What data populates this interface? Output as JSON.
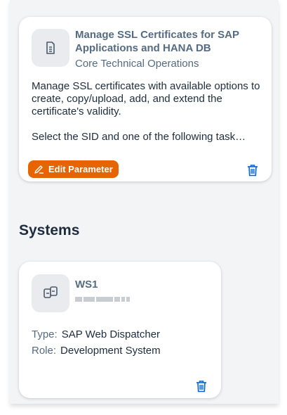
{
  "task_card": {
    "icon": "document-icon",
    "title": "Manage SSL Certificates for SAP Applications and HANA DB",
    "category": "Core Technical Operations",
    "description_1": "Manage SSL certificates with available options to create, copy/upload, add, and extend the certificate's validity.",
    "description_2": "Select the SID and one of the following task…",
    "edit_button_label": "Edit Parameter",
    "delete_icon": "trash-icon"
  },
  "systems_section": {
    "title": "Systems"
  },
  "system_card": {
    "icon": "system-link-icon",
    "name": "WS1",
    "type_label": "Type:",
    "type_value": "SAP Web Dispatcher",
    "role_label": "Role:",
    "role_value": "Development System",
    "delete_icon": "trash-icon"
  },
  "colors": {
    "accent_orange": "#e76500",
    "link_blue": "#0064d9",
    "title_gray": "#556b82"
  }
}
